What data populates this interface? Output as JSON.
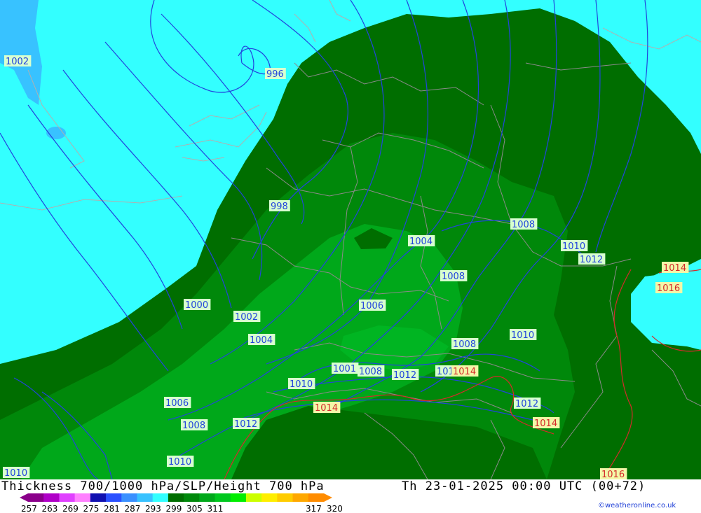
{
  "title": "Thickness 700/1000 hPa/SLP/Height 700 hPa",
  "datetime": "Th 23-01-2025 00:00 UTC (00+72)",
  "credit": "©weatheronline.co.uk",
  "colors": {
    "ocean": "#33ffff",
    "ocean_dark": "#38c2ff",
    "land_dark": "#006e00",
    "land_mid": "#00880a",
    "land_light": "#00a81a",
    "land_bright": "#00b522",
    "isobar_blue": "#2244dd",
    "isobar_red": "#d42a2a",
    "border": "#9a9a9a"
  },
  "legend": {
    "ticks": [
      "257",
      "263",
      "269",
      "275",
      "281",
      "287",
      "293",
      "299",
      "305",
      "311",
      "317",
      "320"
    ],
    "swatches": [
      "#8a008a",
      "#b000c8",
      "#e040ff",
      "#ff80ff",
      "#1010b0",
      "#2a50ff",
      "#3a90ff",
      "#38c2ff",
      "#33ffff",
      "#006e00",
      "#00880a",
      "#00a81a",
      "#00c81e",
      "#00ee00",
      "#ccff00",
      "#ffee00",
      "#ffcc00",
      "#ffa800",
      "#ff8c00"
    ]
  },
  "isobar_labels": [
    {
      "text": "1002",
      "color": "blue"
    },
    {
      "text": "996",
      "color": "blue"
    },
    {
      "text": "998",
      "color": "blue"
    },
    {
      "text": "1000",
      "color": "blue"
    },
    {
      "text": "1002",
      "color": "blue"
    },
    {
      "text": "1004",
      "color": "blue"
    },
    {
      "text": "1004",
      "color": "blue"
    },
    {
      "text": "1006",
      "color": "blue"
    },
    {
      "text": "1008",
      "color": "blue"
    },
    {
      "text": "1008",
      "color": "blue"
    },
    {
      "text": "1010",
      "color": "blue"
    },
    {
      "text": "1012",
      "color": "blue"
    },
    {
      "text": "1014",
      "color": "red"
    },
    {
      "text": "1016",
      "color": "red"
    },
    {
      "text": "1008",
      "color": "blue"
    },
    {
      "text": "1010",
      "color": "blue"
    },
    {
      "text": "1008",
      "color": "blue"
    },
    {
      "text": "1012",
      "color": "blue"
    },
    {
      "text": "101",
      "color": "blue"
    },
    {
      "text": "1014",
      "color": "red"
    },
    {
      "text": "1008",
      "color": "blue"
    },
    {
      "text": "1010",
      "color": "blue"
    },
    {
      "text": "1006",
      "color": "blue"
    },
    {
      "text": "1014",
      "color": "red"
    },
    {
      "text": "1012",
      "color": "blue"
    },
    {
      "text": "1014",
      "color": "red"
    },
    {
      "text": "1008",
      "color": "blue"
    },
    {
      "text": "1012",
      "color": "blue"
    },
    {
      "text": "1010",
      "color": "blue"
    },
    {
      "text": "1010",
      "color": "blue"
    },
    {
      "text": "1016",
      "color": "red"
    },
    {
      "text": "1001",
      "color": "blue"
    }
  ]
}
